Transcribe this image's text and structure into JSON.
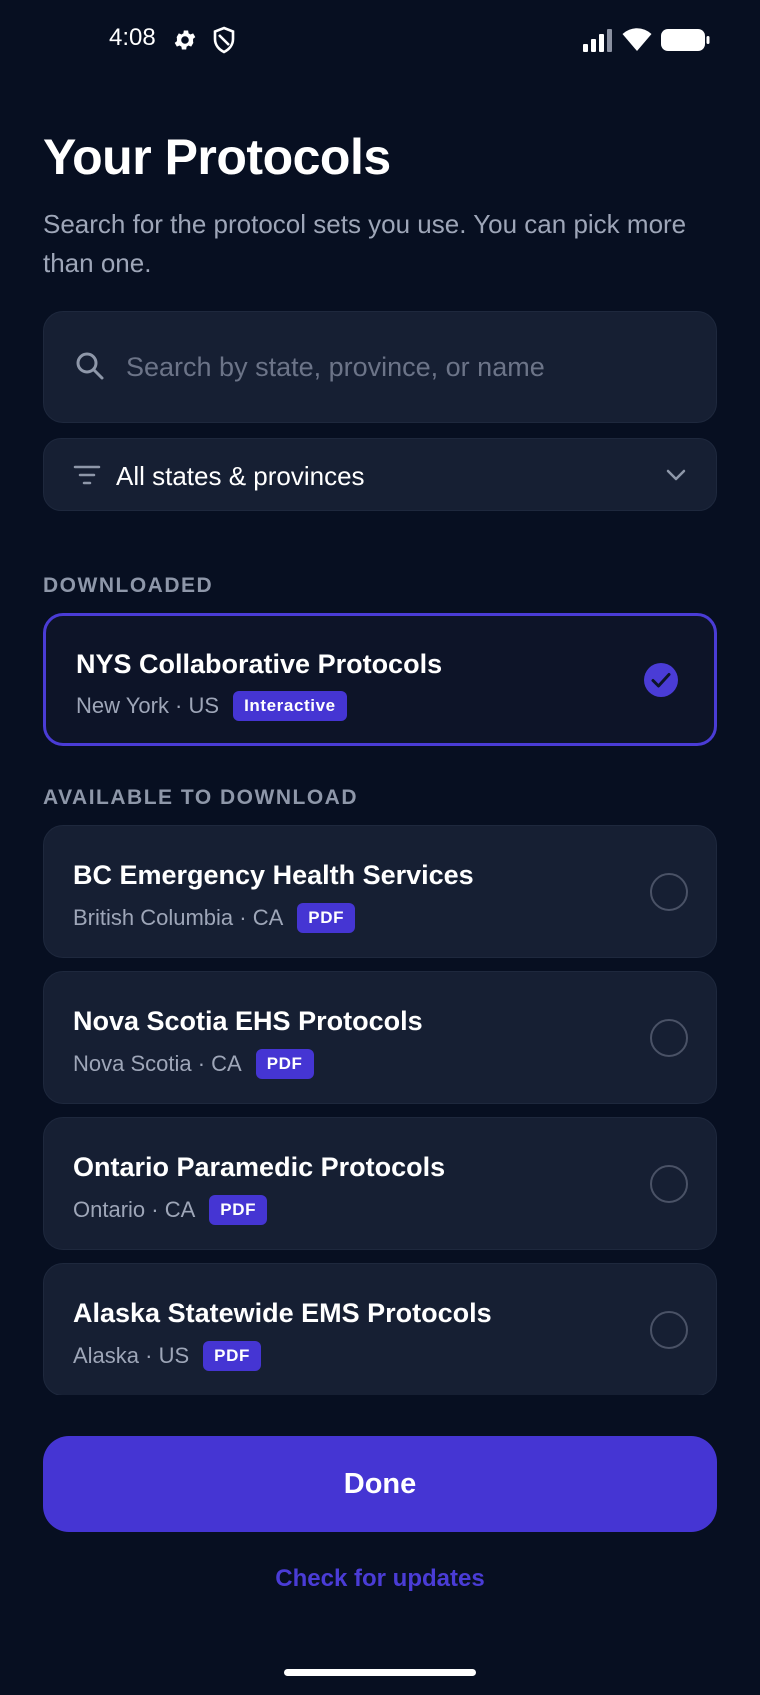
{
  "status_bar": {
    "time": "4:08",
    "icons": [
      "gear-icon",
      "shield-icon",
      "signal-icon",
      "wifi-icon",
      "battery-icon"
    ]
  },
  "header": {
    "title": "Your Protocols",
    "subtitle": "Search for the protocol sets you use. You can pick more than one."
  },
  "search": {
    "placeholder": "Search by state, province, or name",
    "value": ""
  },
  "filter": {
    "selected": "All states & provinces"
  },
  "sections": {
    "downloaded": "DOWNLOADED",
    "available": "AVAILABLE TO DOWNLOAD"
  },
  "downloaded": [
    {
      "title": "NYS Collaborative Protocols",
      "location": "New York · US",
      "badge": "Interactive",
      "selected": true
    }
  ],
  "available": [
    {
      "title": "BC Emergency Health Services",
      "location": "British Columbia · CA",
      "badge": "PDF",
      "selected": false
    },
    {
      "title": "Nova Scotia EHS Protocols",
      "location": "Nova Scotia · CA",
      "badge": "PDF",
      "selected": false
    },
    {
      "title": "Ontario Paramedic Protocols",
      "location": "Ontario · CA",
      "badge": "PDF",
      "selected": false
    },
    {
      "title": "Alaska Statewide EMS Protocols",
      "location": "Alaska · US",
      "badge": "PDF",
      "selected": false
    }
  ],
  "actions": {
    "done": "Done",
    "check_updates": "Check for updates"
  },
  "colors": {
    "background": "#070F21",
    "card": "#161F33",
    "accent": "#4535D3",
    "muted_text": "#9EA6B8"
  }
}
